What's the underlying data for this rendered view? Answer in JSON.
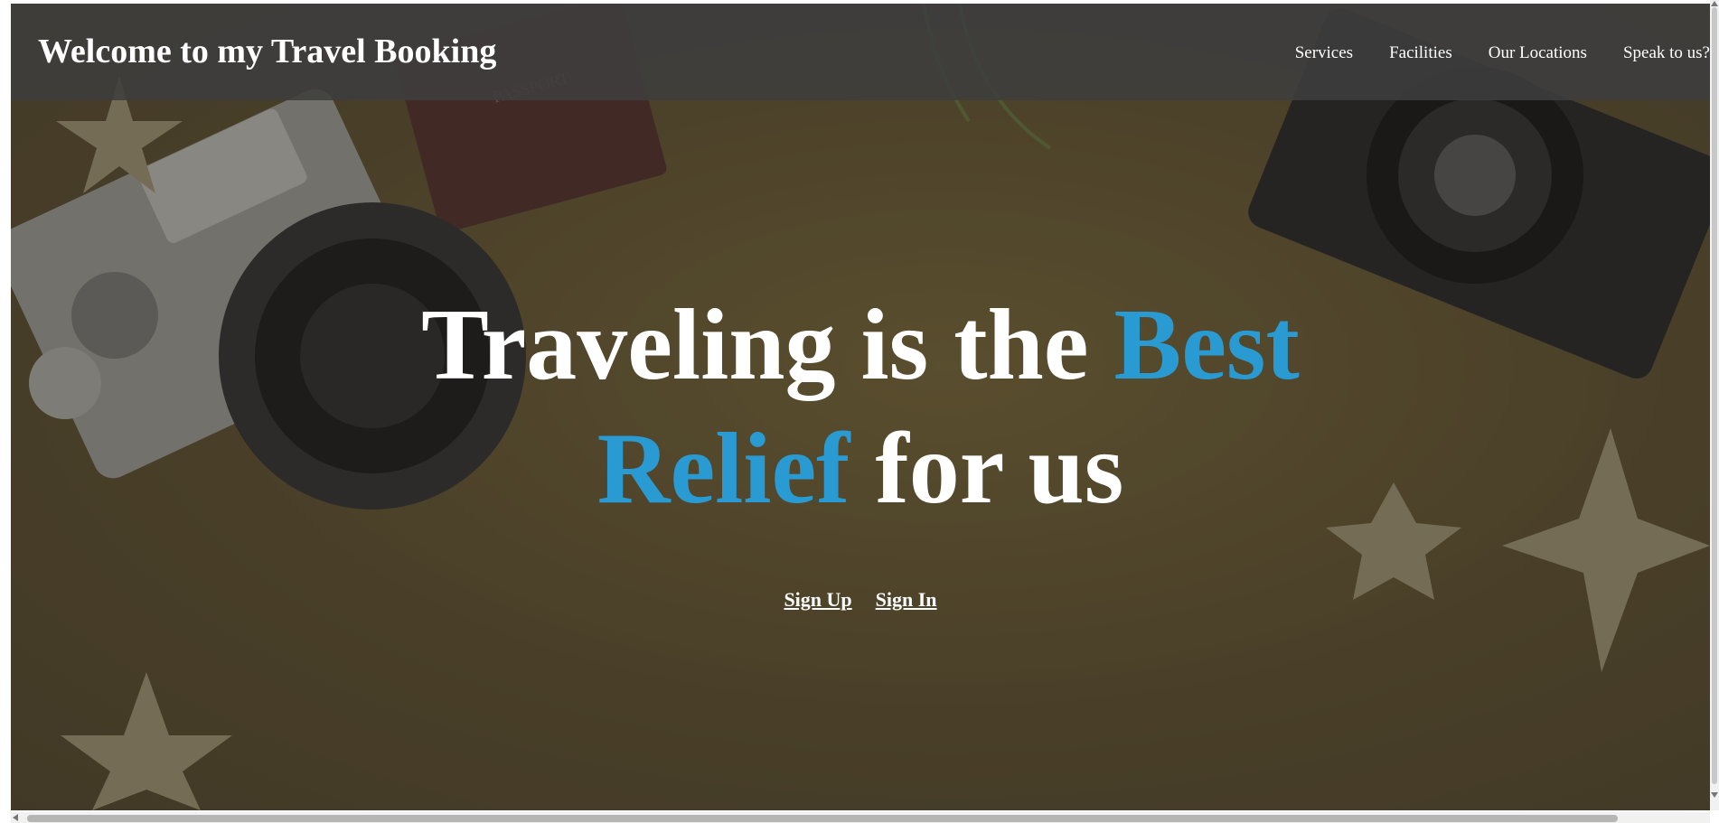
{
  "header": {
    "brand": "Welcome to my Travel Booking",
    "nav": [
      "Services",
      "Facilities",
      "Our Locations",
      "Speak to us?"
    ]
  },
  "hero": {
    "line1_white": "Traveling is the ",
    "line1_blue": "Best",
    "line2_blue": "Relief",
    "line2_white": " for us",
    "accent_color": "#2a9bd2"
  },
  "actions": {
    "sign_up": "Sign Up",
    "sign_in": "Sign In"
  },
  "background": {
    "icons": [
      "camera-left-icon",
      "camera-right-icon",
      "passport-icon",
      "starfish-icon"
    ]
  }
}
